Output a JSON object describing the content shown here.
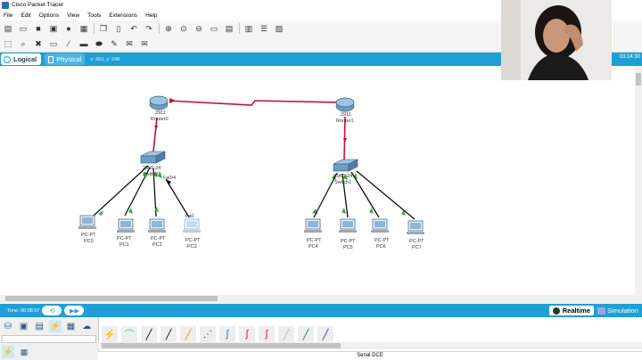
{
  "window": {
    "title": "Cisco Packet Tracer"
  },
  "menu": [
    "File",
    "Edit",
    "Options",
    "View",
    "Tools",
    "Extensions",
    "Help"
  ],
  "modes": {
    "logical": "Logical",
    "physical": "Physical",
    "coords": "x: 353, y: 248",
    "clock": "03:14:30"
  },
  "devices": {
    "router0": {
      "model": "2911",
      "name": "Router0"
    },
    "router1": {
      "model": "2911",
      "name": "Router1"
    },
    "switch0": {
      "model": "2960-24",
      "name": "Switch0",
      "port": "Fa0/4"
    },
    "switch1": {
      "model": "2960-24",
      "name": "Switch1"
    },
    "pcs": [
      {
        "type": "PC-PT",
        "name": "PC0"
      },
      {
        "type": "PC-PT",
        "name": "PC1"
      },
      {
        "type": "PC-PT",
        "name": "PC2"
      },
      {
        "type": "PC-PT",
        "name": "PC3",
        "port": "Fa0"
      },
      {
        "type": "PC-PT",
        "name": "PC4"
      },
      {
        "type": "PC-PT",
        "name": "PC5"
      },
      {
        "type": "PC-PT",
        "name": "PC6"
      },
      {
        "type": "PC-PT",
        "name": "PC7"
      }
    ]
  },
  "timebar": {
    "time": "Time: 00:08:57",
    "realtime": "Realtime",
    "simulation": "Simulation"
  },
  "bottom": {
    "status": "Serial DCE"
  },
  "colors": {
    "accent": "#1f9fd6",
    "serial_link": "#c8102e",
    "link_up": "#3cb043"
  }
}
